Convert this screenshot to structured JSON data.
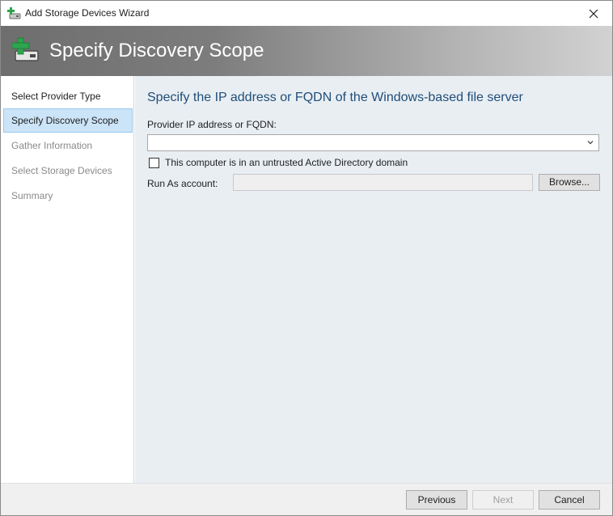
{
  "window": {
    "title": "Add Storage Devices Wizard",
    "icon": "storage-add-icon",
    "close_icon": "close-icon"
  },
  "banner": {
    "title": "Specify Discovery Scope",
    "icon": "storage-add-icon",
    "accent": "#2ea44f"
  },
  "nav": {
    "items": [
      {
        "label": "Select Provider Type",
        "state": "done"
      },
      {
        "label": "Specify Discovery Scope",
        "state": "active"
      },
      {
        "label": "Gather Information",
        "state": "pending"
      },
      {
        "label": "Select Storage Devices",
        "state": "pending"
      },
      {
        "label": "Summary",
        "state": "pending"
      }
    ]
  },
  "main": {
    "heading": "Specify the IP address or FQDN of the Windows-based file server",
    "provider_label": "Provider IP address or FQDN:",
    "provider_value": "",
    "untrusted_label": "This computer is in an untrusted Active Directory domain",
    "untrusted_checked": false,
    "runas_label": "Run As account:",
    "runas_value": "",
    "browse_label": "Browse..."
  },
  "footer": {
    "previous_label": "Previous",
    "next_label": "Next",
    "cancel_label": "Cancel"
  },
  "colors": {
    "heading": "#1f4e79",
    "nav_active_bg": "#cce4f7",
    "content_bg": "#e9eef3"
  }
}
